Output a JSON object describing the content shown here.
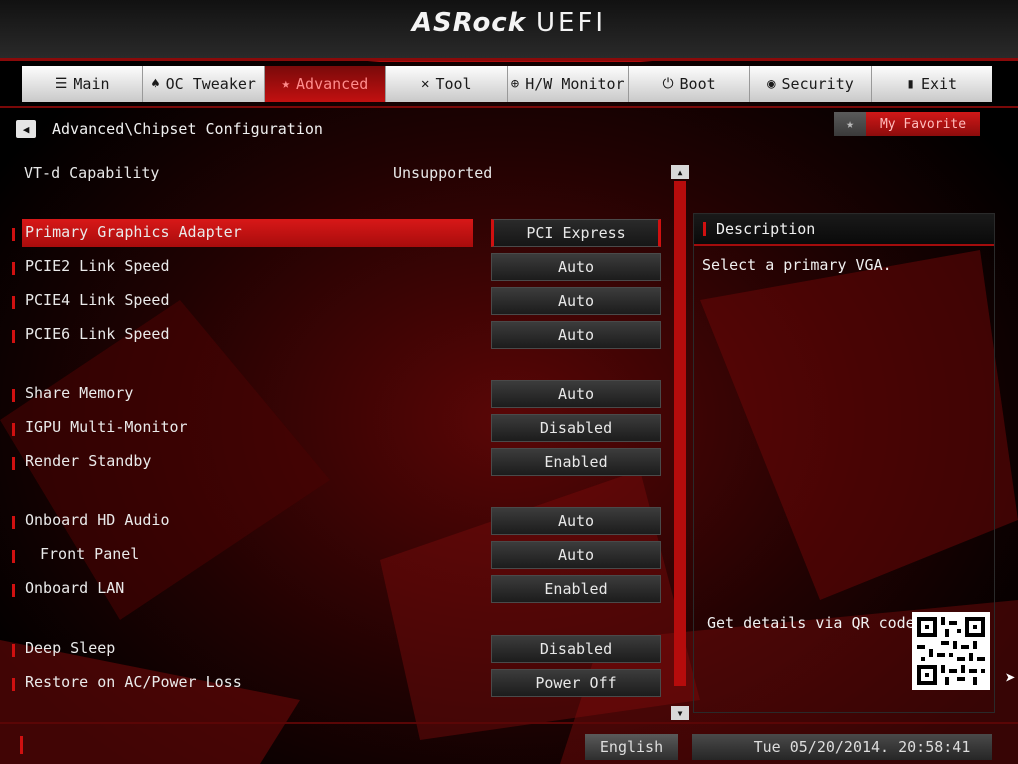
{
  "header": {
    "brand": "ASRock",
    "product": "UEFI"
  },
  "nav": {
    "tabs": [
      {
        "label": "Main",
        "icon": "list-icon",
        "glyph": "☰",
        "active": false
      },
      {
        "label": "OC Tweaker",
        "icon": "rocket-icon",
        "glyph": "♠",
        "active": false
      },
      {
        "label": "Advanced",
        "icon": "star-icon",
        "glyph": "★",
        "active": true
      },
      {
        "label": "Tool",
        "icon": "tools-icon",
        "glyph": "✕",
        "active": false
      },
      {
        "label": "H/W Monitor",
        "icon": "monitor-icon",
        "glyph": "⊕",
        "active": false
      },
      {
        "label": "Boot",
        "icon": "power-icon",
        "glyph": "⏻",
        "active": false
      },
      {
        "label": "Security",
        "icon": "shield-icon",
        "glyph": "◉",
        "active": false
      },
      {
        "label": "Exit",
        "icon": "exit-icon",
        "glyph": "▮",
        "active": false
      }
    ]
  },
  "breadcrumb": {
    "back_icon": "back-arrow-icon",
    "path": "Advanced\\Chipset Configuration"
  },
  "favorite": {
    "label": "My Favorite",
    "icon": "star-icon"
  },
  "info_row": {
    "label": "VT-d Capability",
    "value": "Unsupported"
  },
  "settings": [
    {
      "label": "Primary Graphics Adapter",
      "value": "PCI Express",
      "selected": true,
      "indent": false
    },
    {
      "label": "PCIE2 Link Speed",
      "value": "Auto",
      "selected": false,
      "indent": false
    },
    {
      "label": "PCIE4 Link Speed",
      "value": "Auto",
      "selected": false,
      "indent": false
    },
    {
      "label": "PCIE6 Link Speed",
      "value": "Auto",
      "selected": false,
      "indent": false
    },
    {
      "label": "Share Memory",
      "value": "Auto",
      "selected": false,
      "indent": false
    },
    {
      "label": "IGPU Multi-Monitor",
      "value": "Disabled",
      "selected": false,
      "indent": false
    },
    {
      "label": "Render Standby",
      "value": "Enabled",
      "selected": false,
      "indent": false
    },
    {
      "label": "Onboard HD Audio",
      "value": "Auto",
      "selected": false,
      "indent": false
    },
    {
      "label": "Front Panel",
      "value": "Auto",
      "selected": false,
      "indent": true
    },
    {
      "label": "Onboard LAN",
      "value": "Enabled",
      "selected": false,
      "indent": false
    },
    {
      "label": "Deep Sleep",
      "value": "Disabled",
      "selected": false,
      "indent": false
    },
    {
      "label": "Restore on AC/Power Loss",
      "value": "Power Off",
      "selected": false,
      "indent": false
    }
  ],
  "description": {
    "title": "Description",
    "text": "Select a primary VGA.",
    "qr_label": "Get details via QR code"
  },
  "footer": {
    "language": "English",
    "datetime": "Tue 05/20/2014. 20:58:41"
  },
  "colors": {
    "accent": "#d01010",
    "panel": "#1c1c1c",
    "text": "#e8e8e8"
  }
}
